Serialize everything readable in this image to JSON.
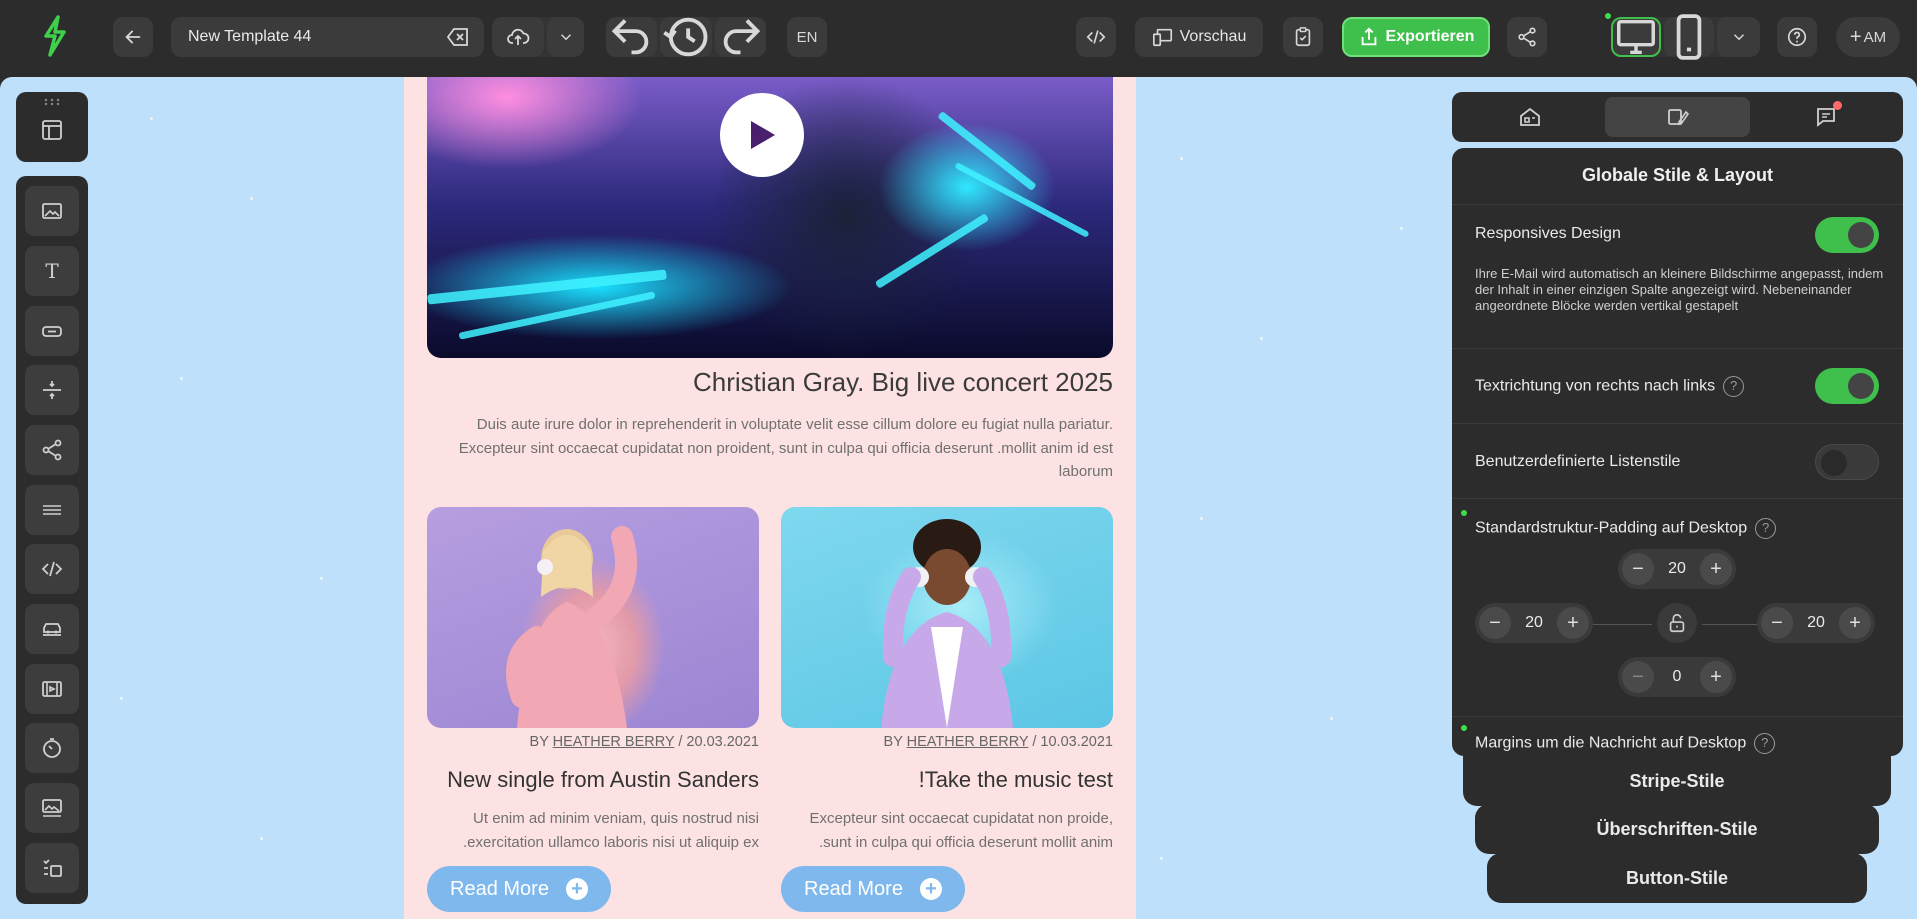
{
  "header": {
    "template_name": "New Template 44",
    "language": "EN",
    "preview_label": "Vorschau",
    "export_label": "Exportieren",
    "user_initials": "AM"
  },
  "email": {
    "hero_title": "Christian Gray. Big live concert 2025",
    "hero_text": "Duis aute irure dolor in reprehenderit in voluptate velit esse cillum dolore eu fugiat nulla pariatur. Excepteur sint occaecat cupidatat non proident, sunt in culpa qui officia deserunt .mollit anim id est laborum",
    "cards": [
      {
        "by_prefix": "BY",
        "author": "HEATHER BERRY",
        "date": "/ 20.03.2021",
        "title": "New single from Austin Sanders",
        "text": "Ut enim ad minim veniam, quis nostrud nisi .exercitation ullamco laboris nisi ut aliquip ex",
        "button": "Read More"
      },
      {
        "by_prefix": "BY",
        "author": "HEATHER BERRY",
        "date": "/ 10.03.2021",
        "title": "!Take the music test",
        "text": "Excepteur sint occaecat cupidatat non proide, .sunt in culpa qui officia deserunt mollit anim",
        "button": "Read More"
      }
    ]
  },
  "panel": {
    "title": "Globale Stile & Layout",
    "responsive_label": "Responsives Design",
    "responsive_desc": "Ihre E-Mail wird automatisch an kleinere Bildschirme angepasst, indem der Inhalt in einer einzigen Spalte angezeigt wird. Nebeneinander angeordnete Blöcke werden vertikal gestapelt",
    "rtl_label": "Textrichtung von rechts nach links",
    "list_styles_label": "Benutzerdefinierte Listenstile",
    "padding_label": "Standardstruktur-Padding auf Desktop",
    "padding_top": "20",
    "padding_left": "20",
    "padding_right": "20",
    "padding_bottom": "0",
    "margins_label": "Margins um die Nachricht auf Desktop",
    "help_glyph": "?",
    "toggles": {
      "responsive": true,
      "rtl": true,
      "list_styles": false
    }
  },
  "accordions": {
    "stripe": "Stripe-Stile",
    "headings": "Überschriften-Stile",
    "buttons": "Button-Stile"
  },
  "colors": {
    "accent_green": "#3fbf4b",
    "canvas_bg": "#bfe0fb",
    "email_bg": "#fde2e3",
    "read_more": "#7fb8ec"
  }
}
